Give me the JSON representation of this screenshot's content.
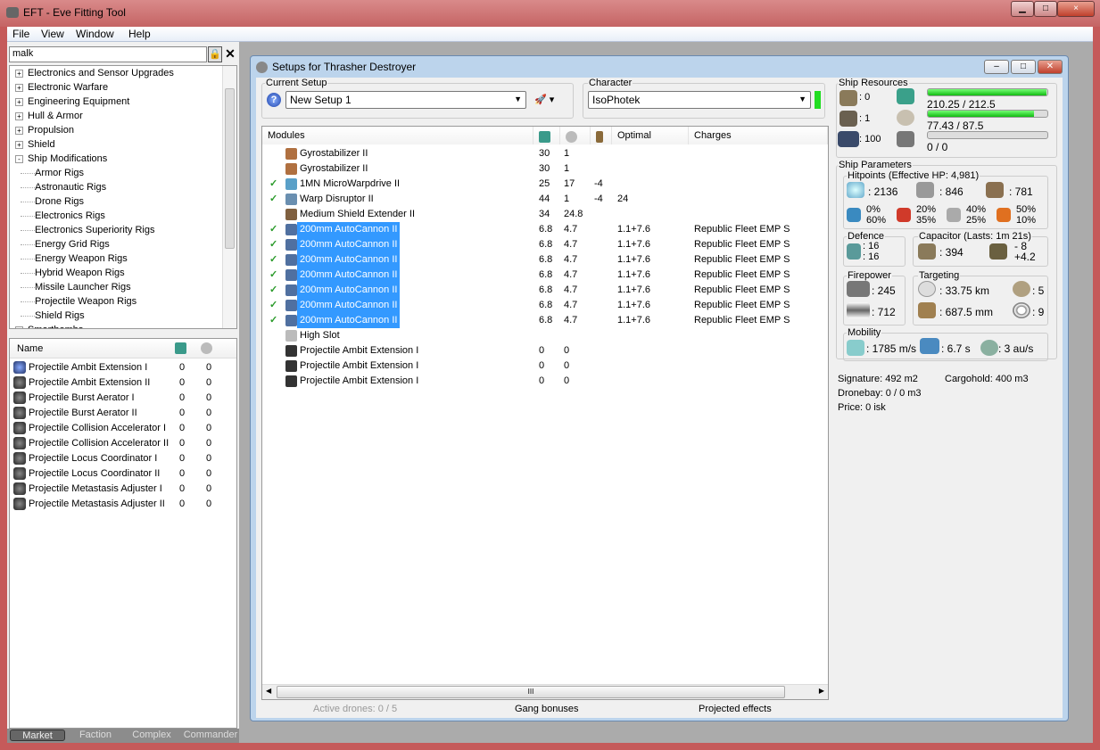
{
  "app": {
    "title": "EFT - Eve Fitting Tool",
    "min": "0",
    "max": "□",
    "close": "×"
  },
  "menu": [
    "File",
    "View",
    "Window",
    "Help"
  ],
  "left": {
    "search_value": "malk",
    "tree": [
      {
        "label": "Electronics and Sensor Upgrades",
        "level": 0,
        "exp": "+"
      },
      {
        "label": "Electronic Warfare",
        "level": 0,
        "exp": "+"
      },
      {
        "label": "Engineering Equipment",
        "level": 0,
        "exp": "+"
      },
      {
        "label": "Hull & Armor",
        "level": 0,
        "exp": "+"
      },
      {
        "label": "Propulsion",
        "level": 0,
        "exp": "+"
      },
      {
        "label": "Shield",
        "level": 0,
        "exp": "+"
      },
      {
        "label": "Ship Modifications",
        "level": 0,
        "exp": "-"
      },
      {
        "label": "Armor Rigs",
        "level": 1
      },
      {
        "label": "Astronautic Rigs",
        "level": 1
      },
      {
        "label": "Drone Rigs",
        "level": 1
      },
      {
        "label": "Electronics Rigs",
        "level": 1
      },
      {
        "label": "Electronics Superiority Rigs",
        "level": 1
      },
      {
        "label": "Energy Grid Rigs",
        "level": 1
      },
      {
        "label": "Energy Weapon Rigs",
        "level": 1
      },
      {
        "label": "Hybrid Weapon Rigs",
        "level": 1
      },
      {
        "label": "Missile Launcher Rigs",
        "level": 1
      },
      {
        "label": "Projectile Weapon Rigs",
        "level": 1
      },
      {
        "label": "Shield Rigs",
        "level": 1
      },
      {
        "label": "Smartbombs",
        "level": 0,
        "exp": "+"
      }
    ],
    "list_header": "Name",
    "list": [
      {
        "name": "Projectile Ambit Extension I",
        "cpu": "0",
        "pg": "0",
        "blue": true
      },
      {
        "name": "Projectile Ambit Extension II",
        "cpu": "0",
        "pg": "0"
      },
      {
        "name": "Projectile Burst Aerator I",
        "cpu": "0",
        "pg": "0"
      },
      {
        "name": "Projectile Burst Aerator II",
        "cpu": "0",
        "pg": "0"
      },
      {
        "name": "Projectile Collision Accelerator I",
        "cpu": "0",
        "pg": "0"
      },
      {
        "name": "Projectile Collision Accelerator II",
        "cpu": "0",
        "pg": "0"
      },
      {
        "name": "Projectile Locus Coordinator I",
        "cpu": "0",
        "pg": "0"
      },
      {
        "name": "Projectile Locus Coordinator II",
        "cpu": "0",
        "pg": "0"
      },
      {
        "name": "Projectile Metastasis Adjuster I",
        "cpu": "0",
        "pg": "0"
      },
      {
        "name": "Projectile Metastasis Adjuster II",
        "cpu": "0",
        "pg": "0"
      }
    ],
    "tabs": [
      "Market",
      "Faction",
      "Complex",
      "Commander"
    ]
  },
  "child": {
    "title": "Setups for Thrasher Destroyer",
    "current_setup_label": "Current Setup",
    "current_setup": "New Setup 1",
    "character_label": "Character",
    "character": "IsoPhotek",
    "columns": [
      "Modules",
      "Optimal",
      "Charges"
    ],
    "modules": [
      {
        "name": "Gyrostabilizer II",
        "cpu": "30",
        "pg": "1",
        "cap": "",
        "opt": "",
        "charge": "",
        "check": false,
        "sel": false,
        "color": "#b07040"
      },
      {
        "name": "Gyrostabilizer II",
        "cpu": "30",
        "pg": "1",
        "cap": "",
        "opt": "",
        "charge": "",
        "check": false,
        "sel": false,
        "color": "#b07040"
      },
      {
        "name": "1MN MicroWarpdrive II",
        "cpu": "25",
        "pg": "17",
        "cap": "-4",
        "opt": "",
        "charge": "",
        "check": true,
        "sel": false,
        "color": "#5aa0c8"
      },
      {
        "name": "Warp Disruptor II",
        "cpu": "44",
        "pg": "1",
        "cap": "-4",
        "opt": "24",
        "charge": "",
        "check": true,
        "sel": false,
        "color": "#6a8fb0"
      },
      {
        "name": "Medium Shield Extender II",
        "cpu": "34",
        "pg": "24.8",
        "cap": "",
        "opt": "",
        "charge": "",
        "check": false,
        "sel": false,
        "color": "#806040"
      },
      {
        "name": "200mm AutoCannon II",
        "cpu": "6.8",
        "pg": "4.7",
        "cap": "",
        "opt": "1.1+7.6",
        "charge": "Republic Fleet EMP S",
        "check": true,
        "sel": true,
        "color": "#5070a0"
      },
      {
        "name": "200mm AutoCannon II",
        "cpu": "6.8",
        "pg": "4.7",
        "cap": "",
        "opt": "1.1+7.6",
        "charge": "Republic Fleet EMP S",
        "check": true,
        "sel": true,
        "color": "#5070a0"
      },
      {
        "name": "200mm AutoCannon II",
        "cpu": "6.8",
        "pg": "4.7",
        "cap": "",
        "opt": "1.1+7.6",
        "charge": "Republic Fleet EMP S",
        "check": true,
        "sel": true,
        "color": "#5070a0"
      },
      {
        "name": "200mm AutoCannon II",
        "cpu": "6.8",
        "pg": "4.7",
        "cap": "",
        "opt": "1.1+7.6",
        "charge": "Republic Fleet EMP S",
        "check": true,
        "sel": true,
        "color": "#5070a0"
      },
      {
        "name": "200mm AutoCannon II",
        "cpu": "6.8",
        "pg": "4.7",
        "cap": "",
        "opt": "1.1+7.6",
        "charge": "Republic Fleet EMP S",
        "check": true,
        "sel": true,
        "color": "#5070a0"
      },
      {
        "name": "200mm AutoCannon II",
        "cpu": "6.8",
        "pg": "4.7",
        "cap": "",
        "opt": "1.1+7.6",
        "charge": "Republic Fleet EMP S",
        "check": true,
        "sel": true,
        "color": "#5070a0"
      },
      {
        "name": "200mm AutoCannon II",
        "cpu": "6.8",
        "pg": "4.7",
        "cap": "",
        "opt": "1.1+7.6",
        "charge": "Republic Fleet EMP S",
        "check": true,
        "sel": true,
        "color": "#5070a0"
      },
      {
        "name": "High Slot",
        "cpu": "",
        "pg": "",
        "cap": "",
        "opt": "",
        "charge": "",
        "check": false,
        "sel": false,
        "color": "#bbbbbb"
      },
      {
        "name": "Projectile Ambit Extension I",
        "cpu": "0",
        "pg": "0",
        "cap": "",
        "opt": "",
        "charge": "",
        "check": false,
        "sel": false,
        "color": "#333333"
      },
      {
        "name": "Projectile Ambit Extension I",
        "cpu": "0",
        "pg": "0",
        "cap": "",
        "opt": "",
        "charge": "",
        "check": false,
        "sel": false,
        "color": "#333333"
      },
      {
        "name": "Projectile Ambit Extension I",
        "cpu": "0",
        "pg": "0",
        "cap": "",
        "opt": "",
        "charge": "",
        "check": false,
        "sel": false,
        "color": "#333333"
      }
    ],
    "scroll_grip": "III",
    "footer": {
      "drones": "Active drones: 0 / 5",
      "gang": "Gang bonuses",
      "projected": "Projected effects"
    }
  },
  "resources": {
    "title": "Ship Resources",
    "turrets": ": 0",
    "launchers": ": 1",
    "drone_bw": ": 100",
    "cpu": "210.25 / 212.5",
    "cpu_fraction": 0.989,
    "pg": "77.43 / 87.5",
    "pg_fraction": 0.885,
    "calib": "0 / 0",
    "calib_fraction": 0
  },
  "params": {
    "title": "Ship Parameters",
    "hp_title": "Hitpoints (Effective HP: 4,981)",
    "shield": ": 2136",
    "armor": ": 846",
    "hull": ": 781",
    "resists": [
      {
        "a": "0%",
        "b": "60%"
      },
      {
        "a": "20%",
        "b": "35%"
      },
      {
        "a": "40%",
        "b": "25%"
      },
      {
        "a": "50%",
        "b": "10%"
      }
    ],
    "defence_title": "Defence",
    "def1": ": 16",
    "def2": ": 16",
    "cap_title": "Capacitor (Lasts: 1m 21s)",
    "cap": ": 394",
    "cap_a": "- 8",
    "cap_b": "+4.2",
    "fire_title": "Firepower",
    "dps": ": 245",
    "volley": ": 712",
    "targ_title": "Targeting",
    "range": ": 33.75 km",
    "scan": ": 687.5 mm",
    "targets": ": 5",
    "sensor": ": 9",
    "mob_title": "Mobility",
    "speed": ": 1785 m/s",
    "align": ": 6.7 s",
    "warp": ": 3 au/s",
    "signature": "Signature: 492 m2",
    "cargo": "Cargohold: 400 m3",
    "dronebay": "Dronebay: 0 / 0 m3",
    "price": "Price: 0 isk"
  },
  "colors": {
    "selection": "#3399ff",
    "green": "#22cc22"
  }
}
